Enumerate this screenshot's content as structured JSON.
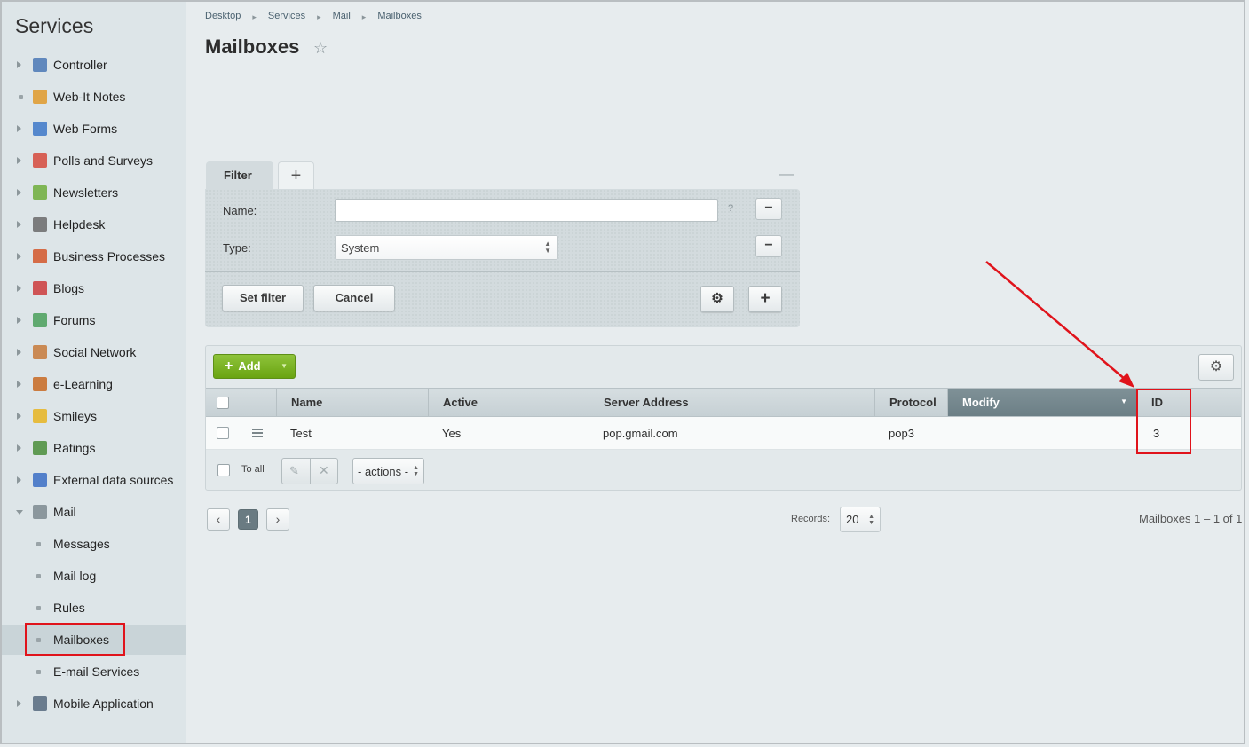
{
  "sidebar": {
    "title": "Services",
    "items": [
      {
        "label": "Controller",
        "icon": "controller-icon"
      },
      {
        "label": "Web-It Notes",
        "icon": "notes-icon"
      },
      {
        "label": "Web Forms",
        "icon": "forms-icon"
      },
      {
        "label": "Polls and Surveys",
        "icon": "polls-icon"
      },
      {
        "label": "Newsletters",
        "icon": "newsletter-icon"
      },
      {
        "label": "Helpdesk",
        "icon": "headset-icon"
      },
      {
        "label": "Business Processes",
        "icon": "bizproc-icon"
      },
      {
        "label": "Blogs",
        "icon": "blog-icon"
      },
      {
        "label": "Forums",
        "icon": "forum-icon"
      },
      {
        "label": "Social Network",
        "icon": "social-icon"
      },
      {
        "label": "e-Learning",
        "icon": "learning-icon"
      },
      {
        "label": "Smileys",
        "icon": "smiley-icon"
      },
      {
        "label": "Ratings",
        "icon": "ratings-icon"
      },
      {
        "label": "External data sources",
        "icon": "rss-icon"
      },
      {
        "label": "Mail",
        "icon": "mail-icon"
      },
      {
        "label": "Messages"
      },
      {
        "label": "Mail log"
      },
      {
        "label": "Rules"
      },
      {
        "label": "Mailboxes"
      },
      {
        "label": "E-mail Services"
      },
      {
        "label": "Mobile Application",
        "icon": "mobile-icon"
      }
    ]
  },
  "breadcrumb": [
    "Desktop",
    "Services",
    "Mail",
    "Mailboxes"
  ],
  "page_title": "Mailboxes",
  "filter": {
    "tab_label": "Filter",
    "add_tab": "+",
    "name_label": "Name:",
    "name_value": "",
    "help": "?",
    "type_label": "Type:",
    "type_value": "System",
    "set_filter": "Set filter",
    "cancel": "Cancel"
  },
  "grid": {
    "add_label": "Add",
    "columns": [
      "Name",
      "Active",
      "Server Address",
      "Protocol",
      "Modify",
      "ID"
    ],
    "rows": [
      {
        "name": "Test",
        "active": "Yes",
        "server": "pop.gmail.com",
        "protocol": "pop3",
        "modify": "",
        "id": "3"
      }
    ],
    "to_all": "To all",
    "actions": "- actions -"
  },
  "pager": {
    "current_page": "1",
    "records_label": "Records:",
    "records_value": "20",
    "total": "Mailboxes 1 – 1 of 1"
  },
  "colors": {
    "annotation": "#e0131b",
    "add_button": "#7ab427"
  }
}
